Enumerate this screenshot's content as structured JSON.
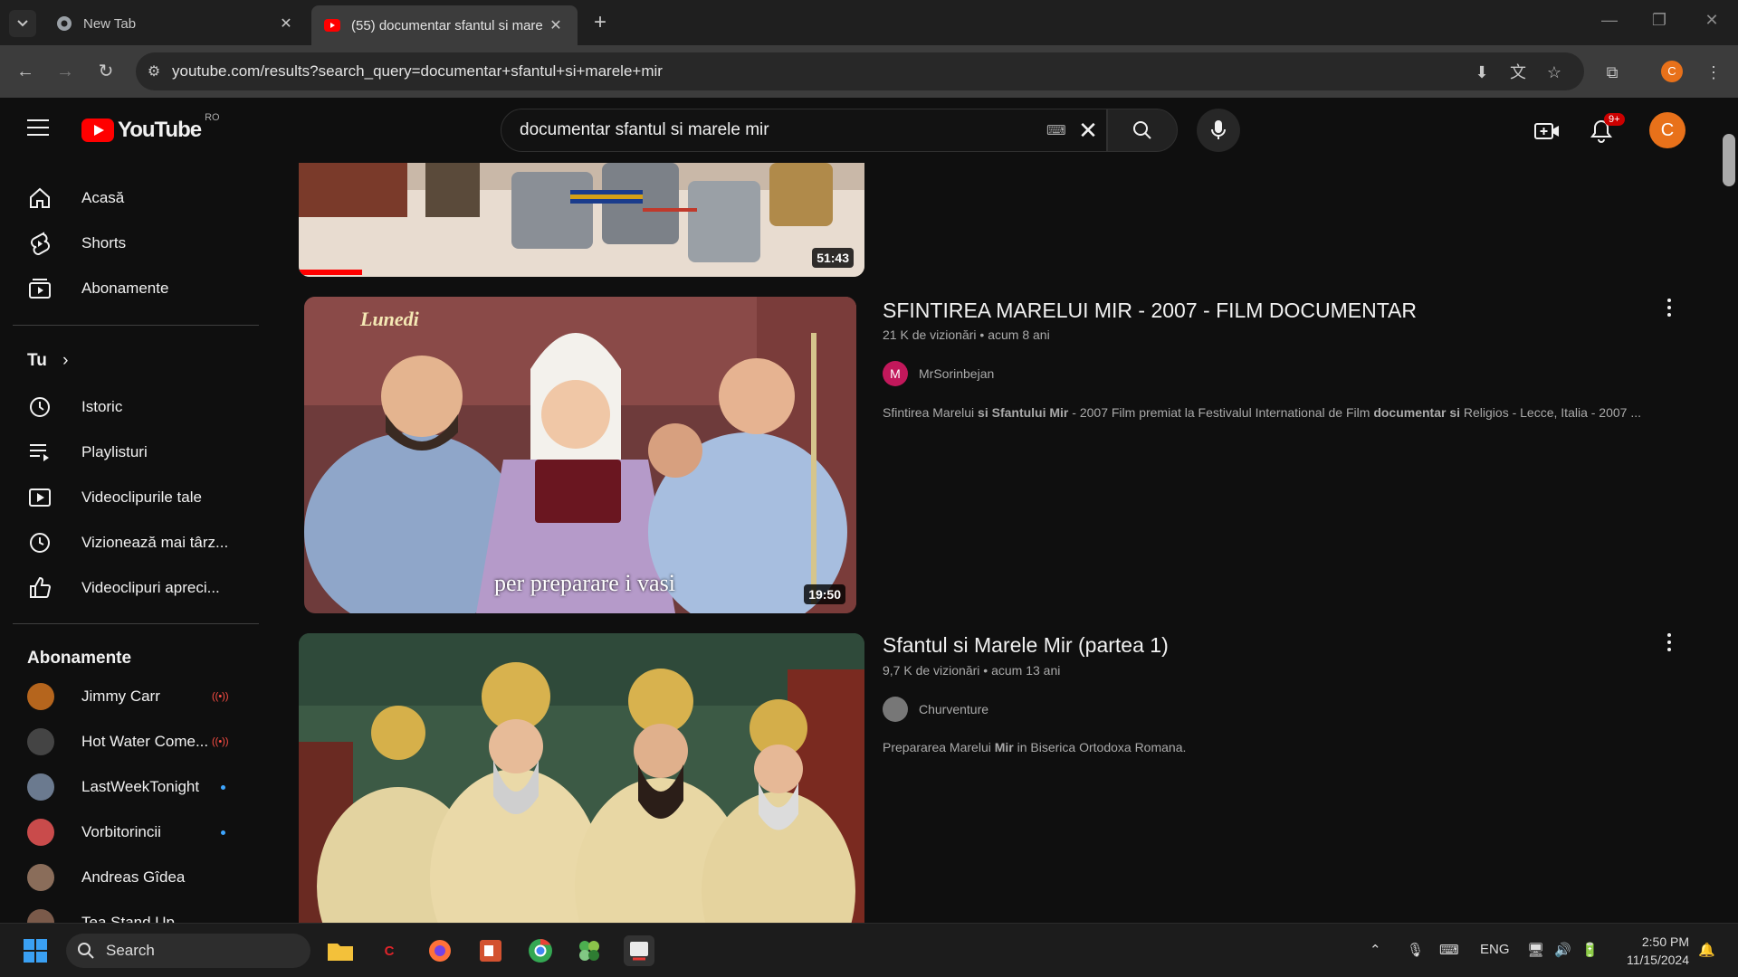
{
  "browser": {
    "tabs": [
      {
        "title": "New Tab",
        "close": "✕"
      },
      {
        "title": "(55) documentar sfantul si mare",
        "close": "✕"
      }
    ],
    "new_tab": "+",
    "url": "youtube.com/results?search_query=documentar+sfantul+si+marele+mir",
    "profile_initial": "C"
  },
  "youtube": {
    "logo_text": "YouTube",
    "country_code": "RO",
    "search_query": "documentar sfantul si marele mir",
    "notification_count": "9+",
    "avatar_initial": "C"
  },
  "sidebar": {
    "main": [
      {
        "label": "Acasă",
        "icon": "home-icon"
      },
      {
        "label": "Shorts",
        "icon": "shorts-icon"
      },
      {
        "label": "Abonamente",
        "icon": "subscriptions-icon"
      }
    ],
    "you_heading": "Tu",
    "you_items": [
      {
        "label": "Istoric",
        "icon": "history-icon"
      },
      {
        "label": "Playlisturi",
        "icon": "playlists-icon"
      },
      {
        "label": "Videoclipurile tale",
        "icon": "your-videos-icon"
      },
      {
        "label": "Vizionează mai târz...",
        "icon": "watch-later-icon"
      },
      {
        "label": "Videoclipuri apreci...",
        "icon": "liked-icon"
      }
    ],
    "subs_heading": "Abonamente",
    "subs": [
      {
        "name": "Jimmy Carr",
        "status": "live",
        "color": "#b5651d"
      },
      {
        "name": "Hot Water Come...",
        "status": "live",
        "color": "#444444"
      },
      {
        "name": "LastWeekTonight",
        "status": "new",
        "color": "#6b7a8f"
      },
      {
        "name": "Vorbitorincii",
        "status": "new",
        "color": "#c94b4b"
      },
      {
        "name": "Andreas Gîdea",
        "status": "",
        "color": "#8a6d5a"
      },
      {
        "name": "Tea Stand Up",
        "status": "",
        "color": "#7a5a4a"
      }
    ]
  },
  "results": [
    {
      "duration": "51:43"
    },
    {
      "title": "SFINTIREA MARELUI MIR - 2007 - FILM DOCUMENTAR",
      "views": "21 K de vizionări",
      "age": "acum 8 ani",
      "channel": "MrSorinbejan",
      "channel_initial": "M",
      "channel_color": "#c2185b",
      "desc_parts": [
        "Sfintirea Marelui ",
        "si Sfantului Mir",
        " - 2007 Film premiat la Festivalul International de Film ",
        "documentar si",
        " Religios - Lecce, Italia - 2007 ..."
      ],
      "duration": "19:50",
      "overlay_top": "Lunedi",
      "overlay_bottom": "per preparare i vasi"
    },
    {
      "title": "Sfantul si Marele Mir (partea 1)",
      "views": "9,7 K de vizionări",
      "age": "acum 13 ani",
      "channel": "Churventure",
      "channel_color": "#777777",
      "desc_parts": [
        "Prepararea Marelui ",
        "Mir",
        " in Biserica Ortodoxa Romana."
      ]
    }
  ],
  "meta_separator": "•",
  "taskbar": {
    "search_placeholder": "Search",
    "language": "ENG",
    "time": "2:50 PM",
    "date": "11/15/2024"
  }
}
